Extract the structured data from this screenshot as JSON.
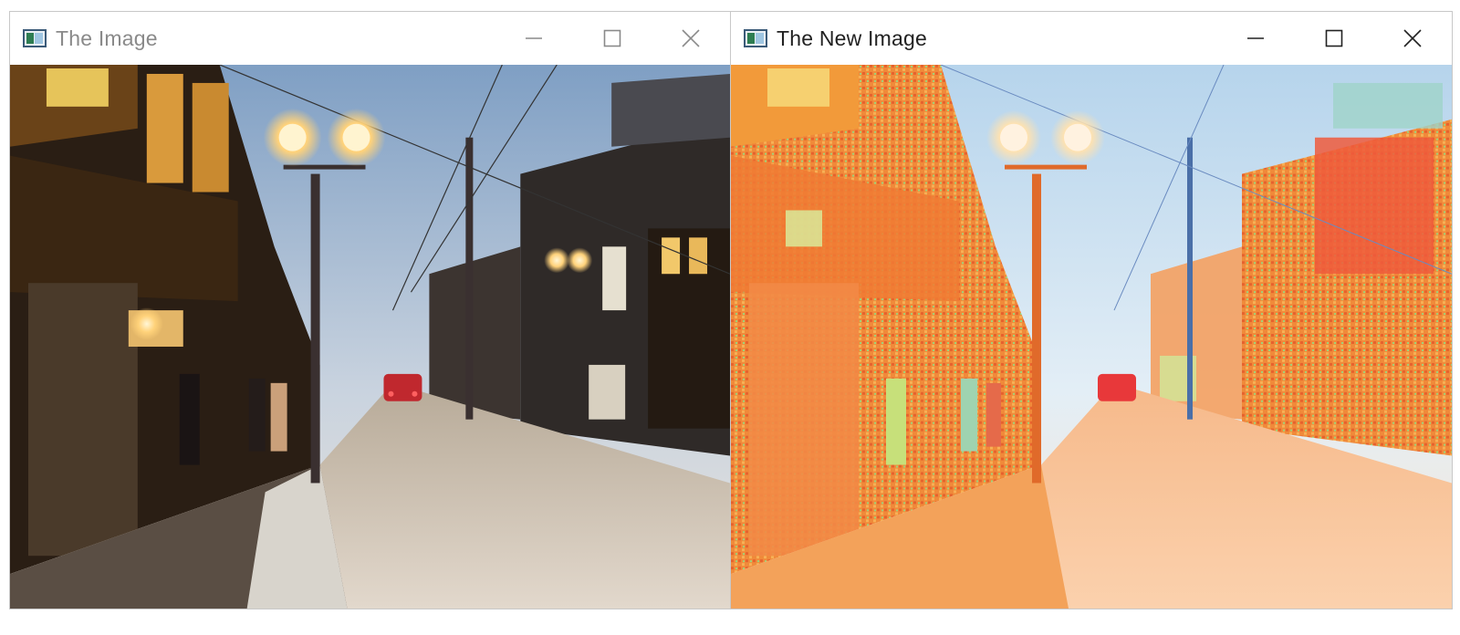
{
  "windows": [
    {
      "title": "The Image",
      "active": false,
      "controls": {
        "minimize": "minimize-icon",
        "maximize": "maximize-icon",
        "close": "close-icon"
      }
    },
    {
      "title": "The New Image",
      "active": true,
      "controls": {
        "minimize": "minimize-icon",
        "maximize": "maximize-icon",
        "close": "close-icon"
      }
    }
  ],
  "colors": {
    "original_sky": "#9db6d2",
    "original_street": "#7a6a55",
    "new_sky": "#cfe3f2",
    "new_street": "#f6a763",
    "new_building": "#f07a34"
  }
}
